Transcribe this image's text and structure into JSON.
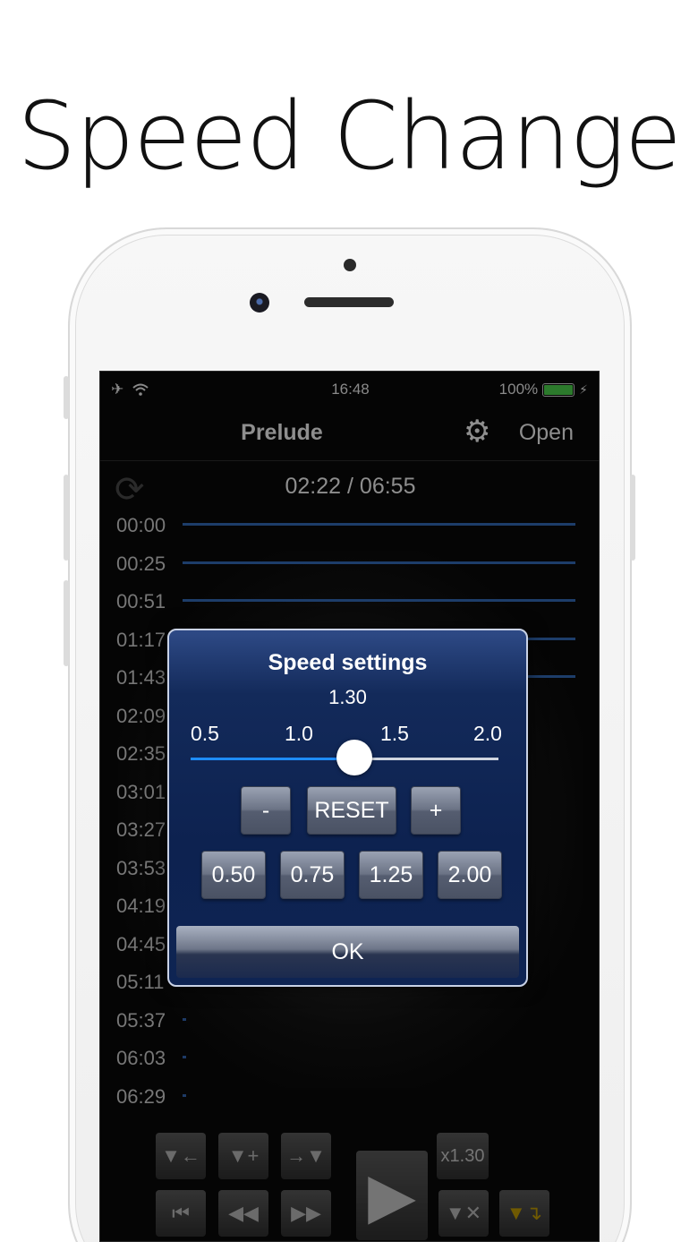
{
  "headline": "Speed Change",
  "statusbar": {
    "airplane_icon": "airplane-icon",
    "wifi_icon": "wifi-icon",
    "time": "16:48",
    "battery_text": "100%",
    "battery_level": 1.0
  },
  "navbar": {
    "title": "Prelude",
    "settings_icon": "gear-icon",
    "open_label": "Open"
  },
  "position": {
    "current": "02:22",
    "separator": "/",
    "total": "06:55"
  },
  "markers": [
    {
      "time": "00:00",
      "line": "long"
    },
    {
      "time": "00:25",
      "line": "long"
    },
    {
      "time": "00:51",
      "line": "long"
    },
    {
      "time": "01:17",
      "line": "long"
    },
    {
      "time": "01:43",
      "line": "long"
    },
    {
      "time": "02:09",
      "line": "none"
    },
    {
      "time": "02:35",
      "line": "none"
    },
    {
      "time": "03:01",
      "line": "none"
    },
    {
      "time": "03:27",
      "line": "none"
    },
    {
      "time": "03:53",
      "line": "none"
    },
    {
      "time": "04:19",
      "line": "none"
    },
    {
      "time": "04:45",
      "line": "none"
    },
    {
      "time": "05:11",
      "line": "none"
    },
    {
      "time": "05:37",
      "line": "short"
    },
    {
      "time": "06:03",
      "line": "short"
    },
    {
      "time": "06:29",
      "line": "short"
    }
  ],
  "controls": {
    "row1": [
      "▼←",
      "▼+",
      "→▼"
    ],
    "row2": [
      "⏮",
      "◀◀",
      "▶▶"
    ],
    "speed_readout": "x1.30"
  },
  "dialog": {
    "title": "Speed settings",
    "value": "1.30",
    "ticks": [
      "0.5",
      "1.0",
      "1.5",
      "2.0"
    ],
    "slider": {
      "min": 0.5,
      "max": 2.0,
      "value": 1.3
    },
    "minus_label": "-",
    "reset_label": "RESET",
    "plus_label": "+",
    "presets": [
      "0.50",
      "0.75",
      "1.25",
      "2.00"
    ],
    "ok_label": "OK"
  },
  "colors": {
    "accent": "#1e8cff",
    "dialog_bg": "#0d2250",
    "marker_line": "#1d3d6a",
    "battery": "#2c7a2c"
  }
}
